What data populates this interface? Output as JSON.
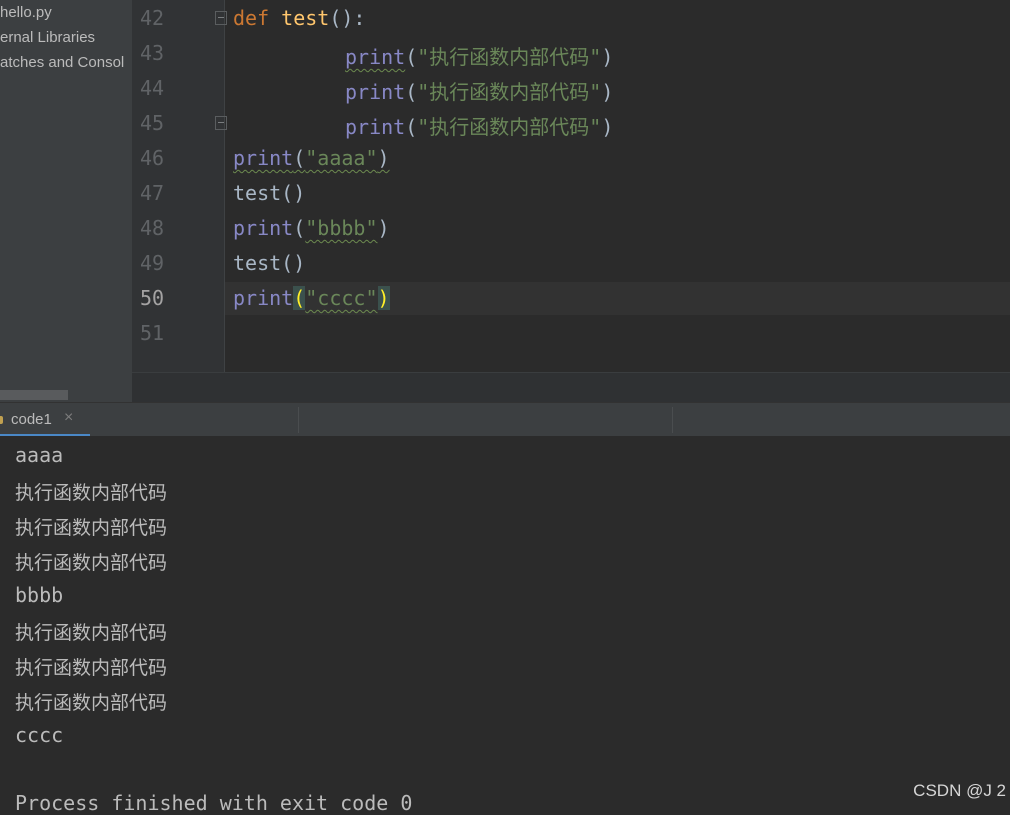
{
  "project_tree": {
    "items": [
      "hello.py",
      "ernal Libraries",
      "atches and Consol"
    ]
  },
  "editor": {
    "line_numbers": [
      "42",
      "43",
      "44",
      "45",
      "46",
      "47",
      "48",
      "49",
      "50",
      "51"
    ],
    "current_line": "50",
    "lines": [
      {
        "def_kw": "def ",
        "fn_name": "test",
        "punct": "():"
      },
      {
        "call": "print",
        "open": "(",
        "str": "\"执行函数内部代码\"",
        "close": ")"
      },
      {
        "call": "print",
        "open": "(",
        "str": "\"执行函数内部代码\"",
        "close": ")"
      },
      {
        "call": "print",
        "open": "(",
        "str": "\"执行函数内部代码\"",
        "close": ")"
      },
      {
        "call": "print",
        "open": "(",
        "str": "\"aaaa\"",
        "close": ")"
      },
      {
        "plain": "test()"
      },
      {
        "call": "print",
        "open": "(",
        "str": "\"bbbb\"",
        "close": ")"
      },
      {
        "plain": "test()"
      },
      {
        "call": "print",
        "open": "(",
        "str": "\"cccc\"",
        "close": ")"
      }
    ]
  },
  "run_panel": {
    "tab_label": "code1",
    "tab_close": "×",
    "output": [
      "aaaa",
      "执行函数内部代码",
      "执行函数内部代码",
      "执行函数内部代码",
      "bbbb",
      "执行函数内部代码",
      "执行函数内部代码",
      "执行函数内部代码",
      "cccc",
      "",
      "Process finished with exit code 0"
    ]
  },
  "watermark": "CSDN @J 2",
  "colors": {
    "background": "#2b2b2b",
    "keyword": "#cc7832",
    "function": "#ffc66d",
    "builtin": "#8888c6",
    "string": "#6a8759",
    "tab_accent": "#4a88c7"
  },
  "icons": [
    "fold-open-icon",
    "fold-close-icon",
    "close-icon",
    "run-config-icon"
  ]
}
